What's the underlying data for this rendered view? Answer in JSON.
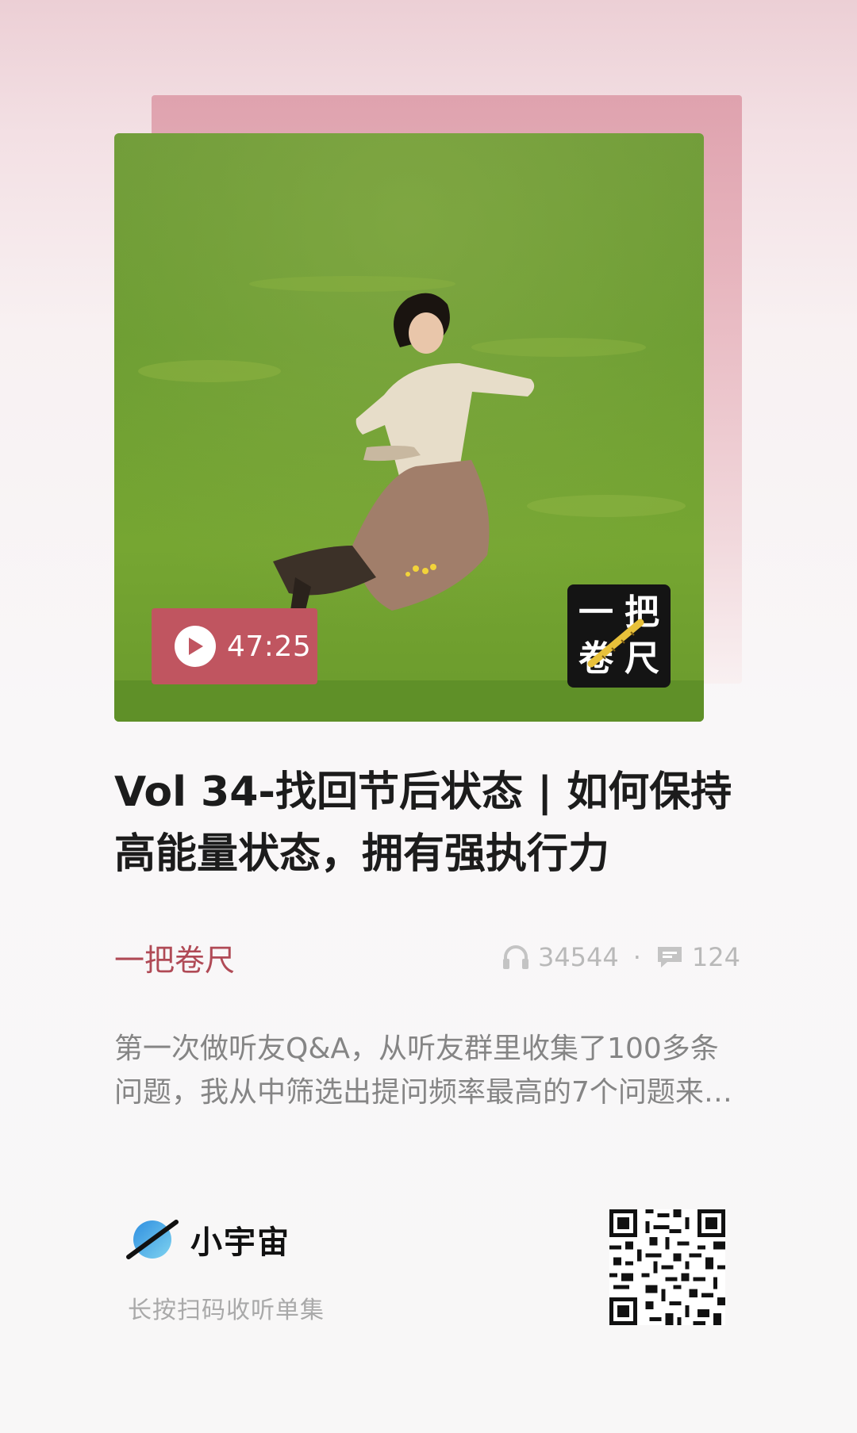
{
  "episode": {
    "duration": "47:25",
    "title": "Vol 34-找回节后状态 | 如何保持高能量状态，拥有强执行力",
    "author": "一把卷尺",
    "plays": "34544",
    "separator": "·",
    "comments": "124",
    "description": "第一次做听友Q&A，从听友群里收集了100多条问题，我从中筛选出提问频率最高的7个问题来回答。"
  },
  "cover": {
    "logo_chars": [
      "一",
      "把",
      "卷",
      "尺"
    ]
  },
  "footer": {
    "brand_name": "小宇宙",
    "hint": "长按扫码收听单集"
  },
  "colors": {
    "accent": "#c05560",
    "author": "#b04a56",
    "title": "#1c1c1c",
    "muted": "#b9b9b9"
  },
  "icons": {
    "play": "play-icon",
    "headphones": "headphones-icon",
    "comment": "comment-icon",
    "logo": "planet-logo-icon",
    "qr": "qr-code-icon"
  }
}
